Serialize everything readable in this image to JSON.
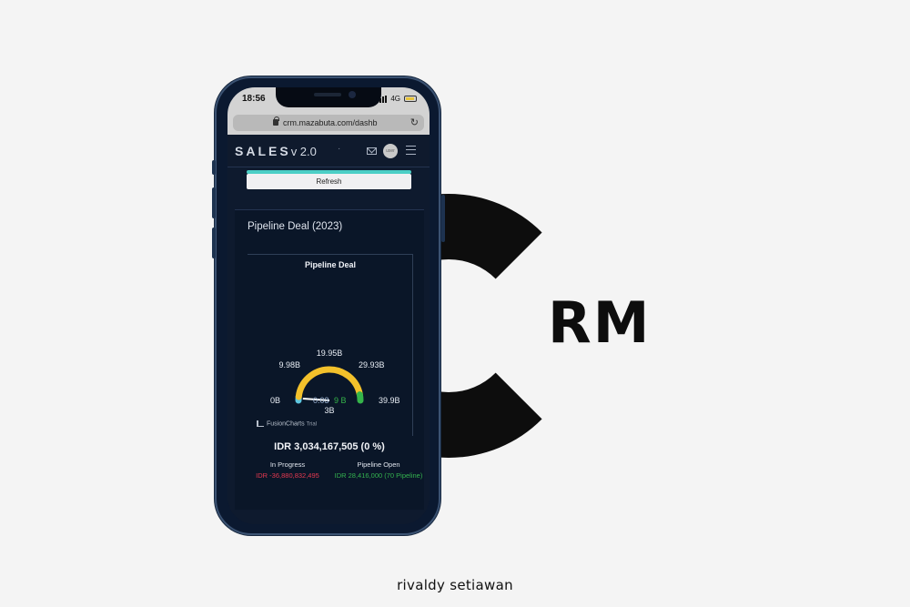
{
  "author": "rivaldy setiawan",
  "logo": {
    "letters": "RM"
  },
  "phone": {
    "status": {
      "time": "18:56",
      "network": "4G"
    },
    "browser": {
      "url": "crm.mazabuta.com/dashb"
    },
    "navbar": {
      "brand": "SALES",
      "version": "v 2.0",
      "separator": "·",
      "avatar_text": "user"
    },
    "refresh_label": "Refresh",
    "card": {
      "title": "Pipeline Deal (2023)",
      "total": "IDR 3,034,167,505 (0 %)",
      "in_progress": {
        "label": "In Progress",
        "value": "IDR -36,880,832,495"
      },
      "pipeline_open": {
        "label": "Pipeline Open",
        "value": "IDR 28,416,000 (70 Pipeline)"
      }
    },
    "fusioncharts": {
      "brand": "FusionCharts",
      "trial": "Trial"
    }
  },
  "chart_data": {
    "type": "gauge",
    "title": "Pipeline Deal",
    "min": 0,
    "max": 39.9,
    "unit": "B",
    "tick_labels": [
      "0B",
      "9.98B",
      "19.95B",
      "29.93B",
      "39.9B"
    ],
    "bands": [
      {
        "from": 0,
        "to": 1.5,
        "color": "#5ec6e0"
      },
      {
        "from": 1.5,
        "to": 37.5,
        "color": "#f3c12b"
      },
      {
        "from": 37.5,
        "to": 39.9,
        "color": "#35b44a"
      }
    ],
    "value": 3.0,
    "value_label": "3B",
    "overlay_text": "0.03",
    "overlay_text2": "9 B",
    "colors": {
      "low": "#5ec6e0",
      "mid": "#f3c12b",
      "high": "#35b44a"
    }
  }
}
